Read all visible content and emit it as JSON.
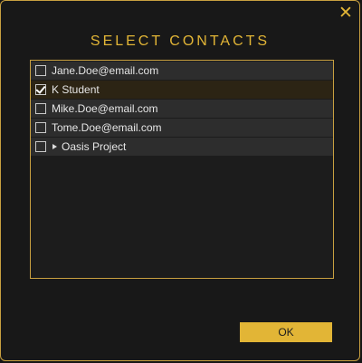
{
  "dialog": {
    "title": "SELECT CONTACTS",
    "close_icon": "close-icon",
    "ok_label": "OK"
  },
  "colors": {
    "accent": "#e2b536",
    "background": "#181818"
  },
  "contacts": [
    {
      "label": "Jane.Doe@email.com",
      "checked": false
    },
    {
      "label": "K Student",
      "checked": true
    },
    {
      "label": "Mike.Doe@email.com",
      "checked": false
    },
    {
      "label": "Tome.Doe@email.com",
      "checked": false
    },
    {
      "label": "Oasis Project",
      "checked": false,
      "expandable": true
    }
  ]
}
